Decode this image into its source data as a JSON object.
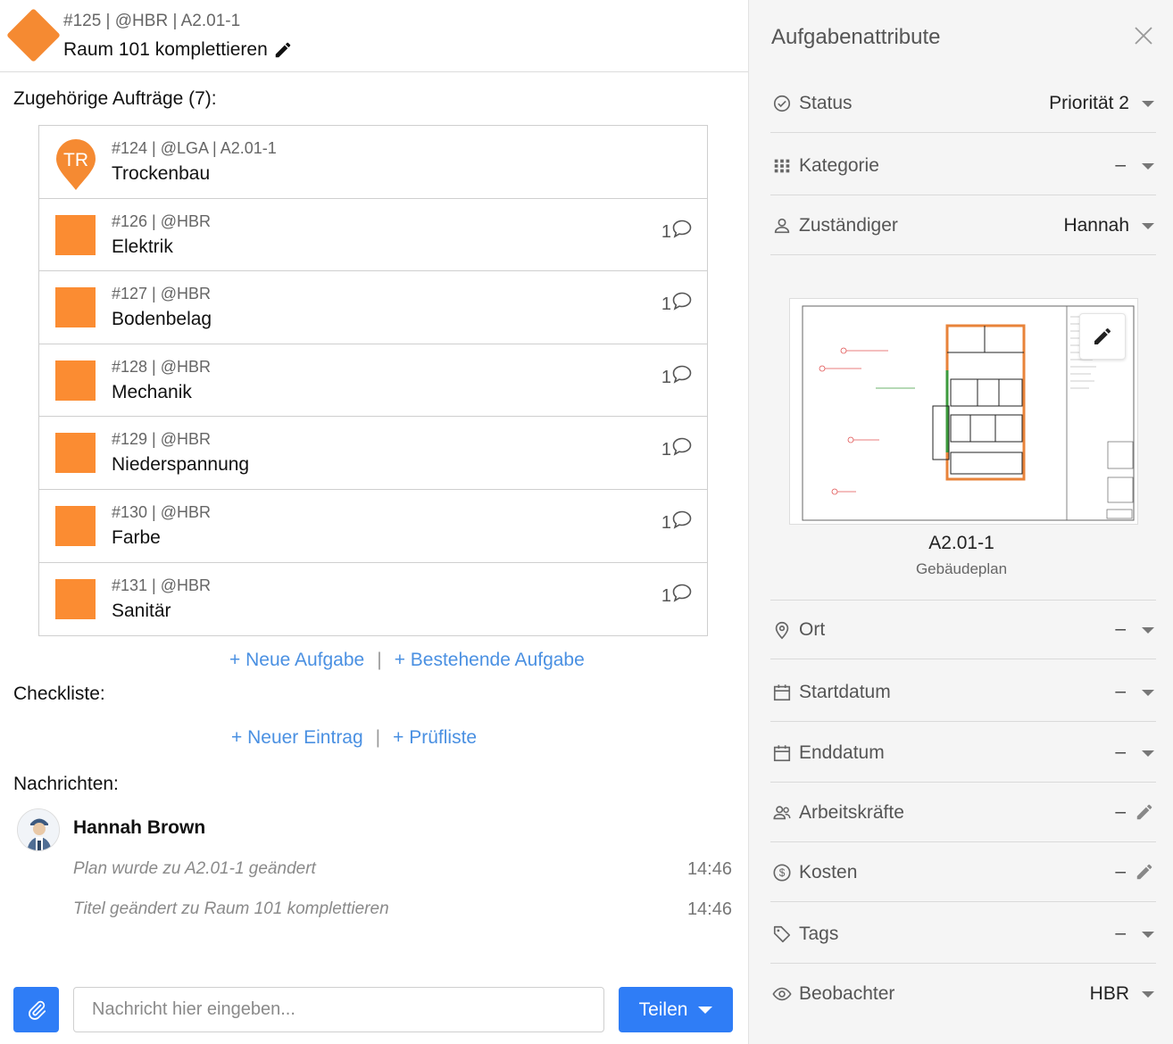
{
  "header": {
    "meta": "#125 | @HBR | A2.01-1",
    "title": "Raum 101 komplettieren"
  },
  "orders": {
    "label": "Zugehörige Aufträge (7):",
    "items": [
      {
        "meta": "#124 | @LGA | A2.01-1",
        "name": "Trockenbau",
        "badge": "TR",
        "comments": ""
      },
      {
        "meta": "#126 | @HBR",
        "name": "Elektrik",
        "comments": "1"
      },
      {
        "meta": "#127 | @HBR",
        "name": "Bodenbelag",
        "comments": "1"
      },
      {
        "meta": "#128 | @HBR",
        "name": "Mechanik",
        "comments": "1"
      },
      {
        "meta": "#129 | @HBR",
        "name": "Niederspannung",
        "comments": "1"
      },
      {
        "meta": "#130 | @HBR",
        "name": "Farbe",
        "comments": "1"
      },
      {
        "meta": "#131 | @HBR",
        "name": "Sanitär",
        "comments": "1"
      }
    ],
    "new_task": "+ Neue Aufgabe",
    "existing_task": "+ Bestehende Aufgabe",
    "separator": "|"
  },
  "checklist": {
    "label": "Checkliste:",
    "new_entry": "+ Neuer Eintrag",
    "checklist_link": "+ Prüfliste",
    "separator": "|"
  },
  "messages": {
    "label": "Nachrichten:",
    "author": "Hannah Brown",
    "entries": [
      {
        "text": "Plan wurde zu A2.01-1 geändert",
        "time": "14:46"
      },
      {
        "text": "Titel geändert zu Raum 101 komplettieren",
        "time": "14:46"
      }
    ]
  },
  "composer": {
    "placeholder": "Nachricht hier eingeben...",
    "share": "Teilen"
  },
  "panel": {
    "title": "Aufgabenattribute",
    "attributes": {
      "status": {
        "label": "Status",
        "value": "Priorität 2"
      },
      "category": {
        "label": "Kategorie",
        "value": "–"
      },
      "assignee": {
        "label": "Zuständiger",
        "value": "Hannah"
      },
      "location": {
        "label": "Ort",
        "value": "–"
      },
      "start": {
        "label": "Startdatum",
        "value": "–"
      },
      "end": {
        "label": "Enddatum",
        "value": "–"
      },
      "workers": {
        "label": "Arbeitskräfte",
        "value": "–"
      },
      "cost": {
        "label": "Kosten",
        "value": "–"
      },
      "tags": {
        "label": "Tags",
        "value": "–"
      },
      "watchers": {
        "label": "Beobachter",
        "value": "HBR"
      }
    },
    "plan": {
      "name": "A2.01-1",
      "type": "Gebäudeplan"
    }
  },
  "colors": {
    "accent": "#2f7df6",
    "link": "#4a90e2",
    "task_orange": "#f58a32"
  }
}
